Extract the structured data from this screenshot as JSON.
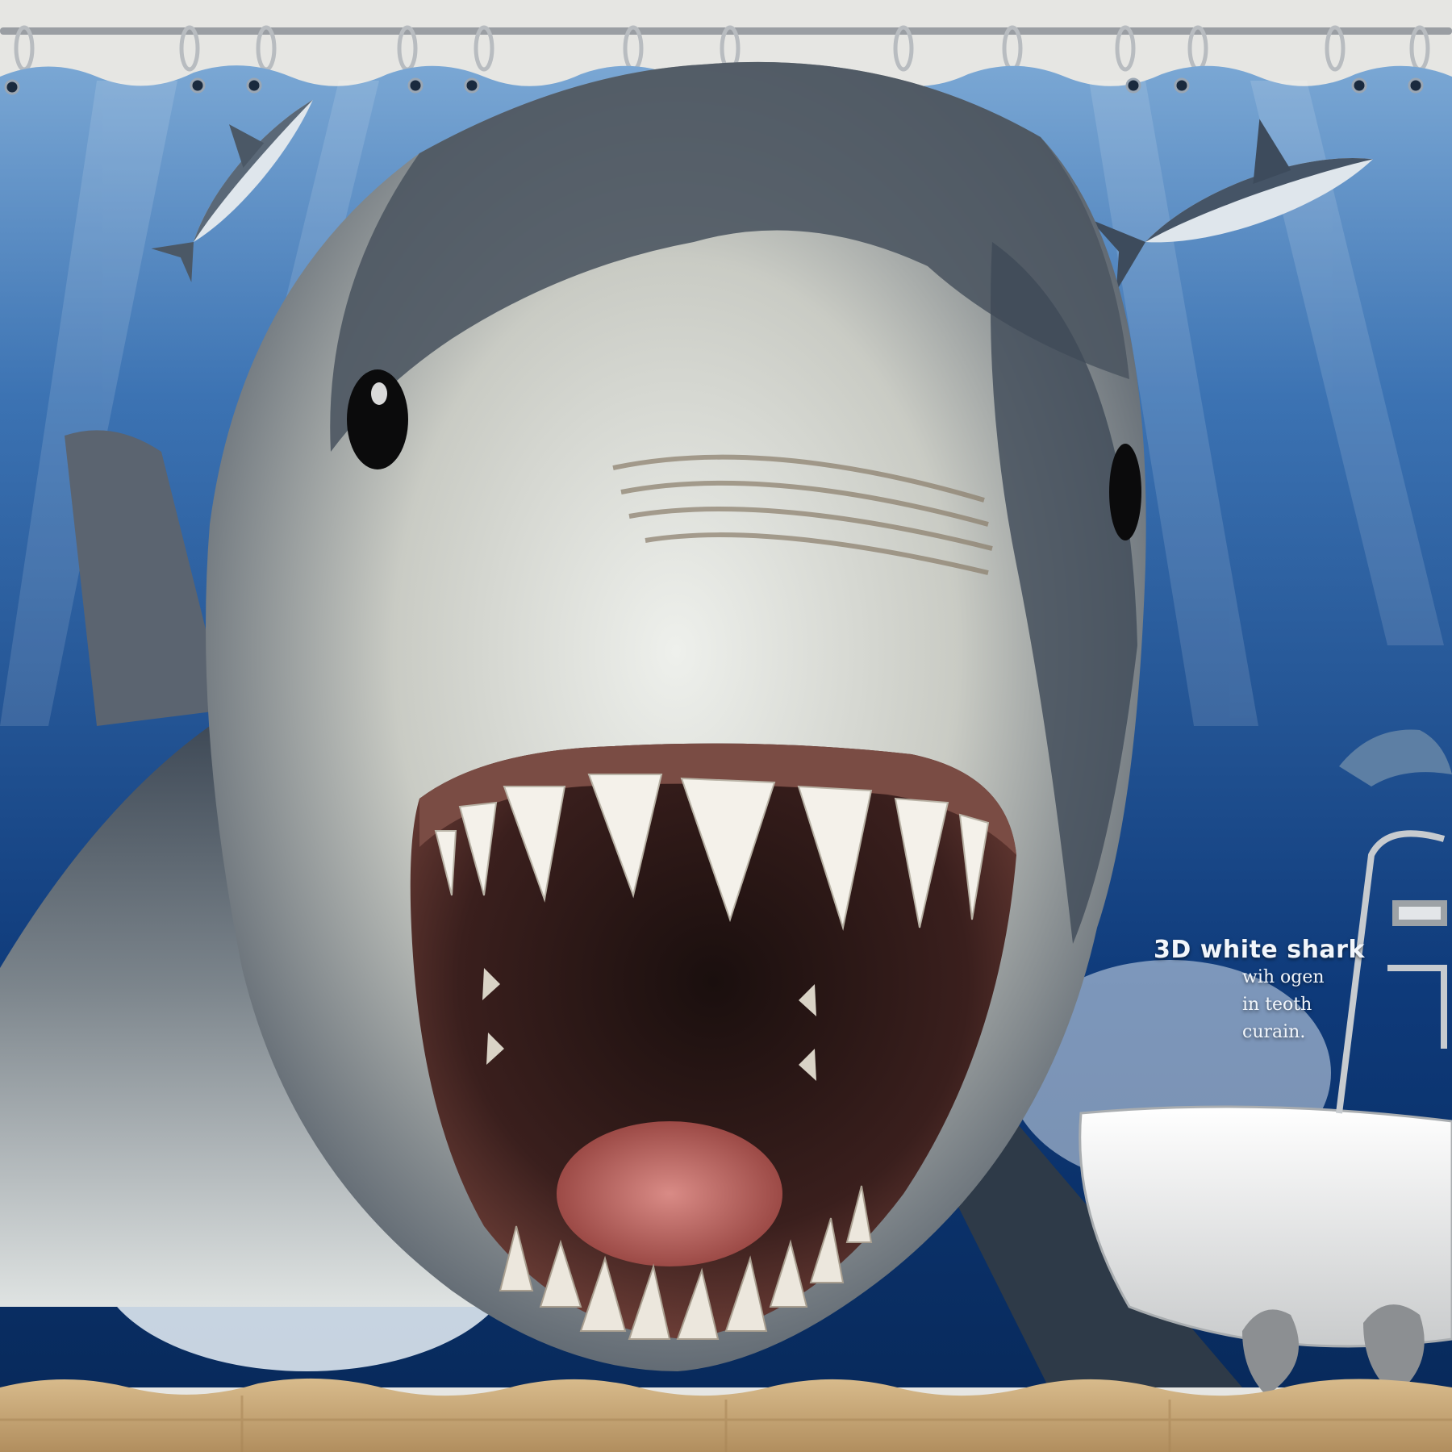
{
  "caption": {
    "title": "3D white shark",
    "lines": [
      "wih ogen",
      "in teoth",
      "curain."
    ]
  },
  "colors": {
    "ocean_deep": "#0e3a7a",
    "ocean_light": "#4f86c2",
    "shark_back": "#5b6470",
    "shark_belly": "#e9eef0",
    "mouth": "#3a1f1d",
    "tongue": "#c46a6a",
    "teeth": "#f4f1ea",
    "wall": "#e7e7e4",
    "floor": "#c9a877",
    "tub": "#f1f1ef"
  }
}
